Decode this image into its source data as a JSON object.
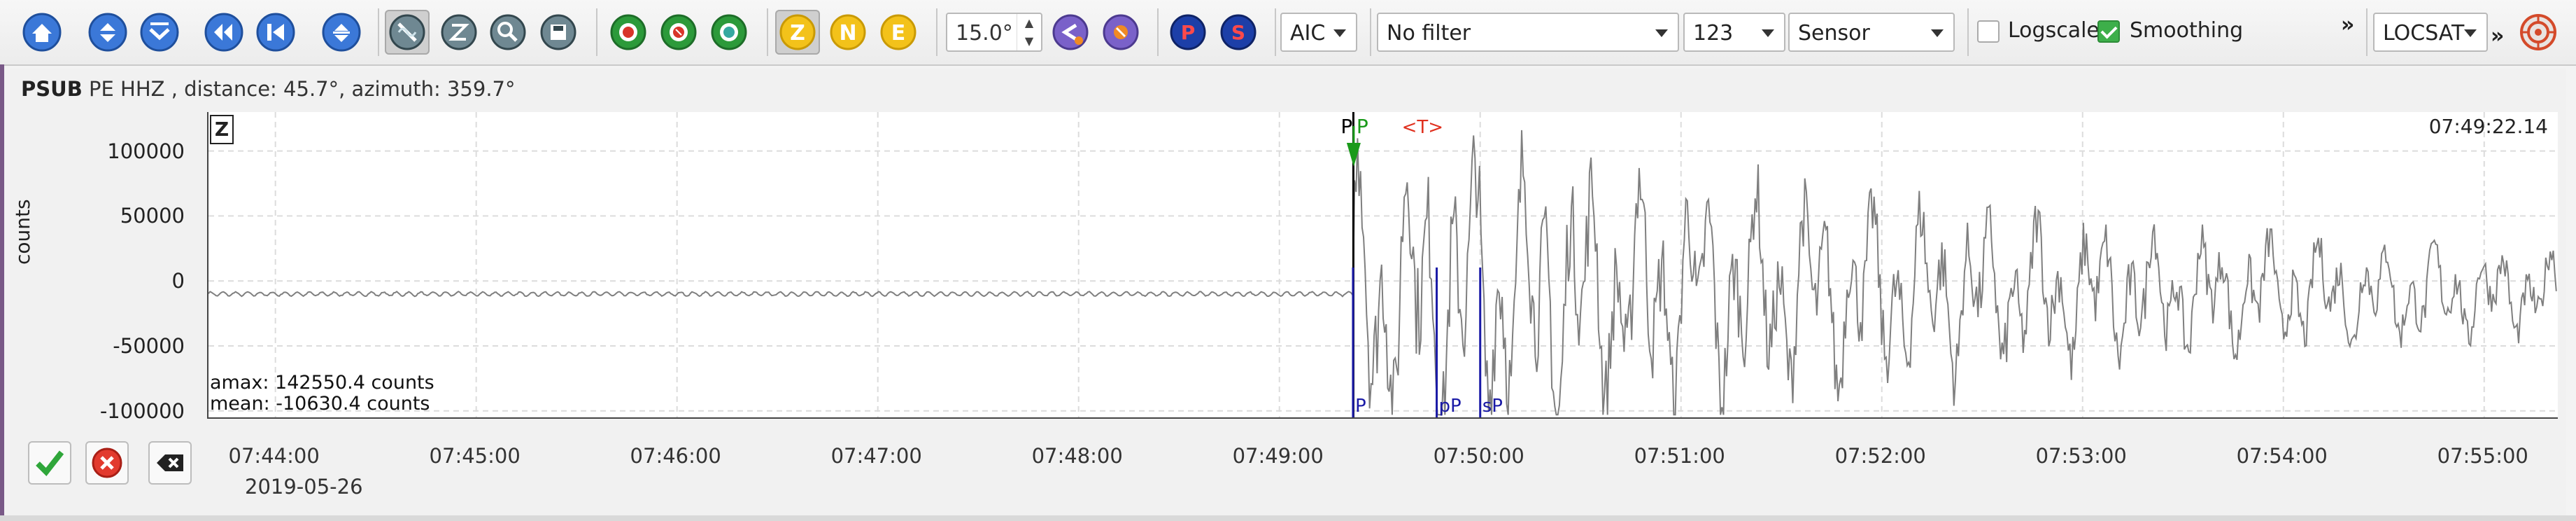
{
  "toolbar": {
    "nav_icons": [
      "home-icon",
      "up-down-icon",
      "down-icon",
      "back-icon",
      "first-icon",
      "expand-icon"
    ],
    "tool_icons": [
      "no-filter-icon",
      "zoom-icon",
      "magnify-icon",
      "save-icon"
    ],
    "phase_icons": [
      "p-phase-icon",
      "s-phase-icon",
      "relocate-icon"
    ],
    "components": {
      "z": "Z",
      "n": "N",
      "e": "E"
    },
    "spin_value": "15.0°",
    "misc_icons": [
      "trace-up-icon",
      "trace-down-icon"
    ],
    "pick_buttons": {
      "p": "P",
      "s": "S"
    },
    "method_select": "AIC",
    "filter_select": "No filter",
    "rotation_select": "123",
    "unit_select": "Sensor",
    "logscale_label": "Logscale",
    "logscale_checked": false,
    "smoothing_label": "Smoothing",
    "smoothing_checked": true,
    "more_glyph": "»",
    "locator_select": "LOCSAT",
    "locator_more_glyph": "»",
    "locator_icon": "target-icon"
  },
  "trace": {
    "station": "PSUB",
    "header_rest": "PE  HHZ , distance: 45.7°, azimuth: 359.7°",
    "component": "Z",
    "time_label": "07:49:22.14",
    "y_axis_label": "counts",
    "amax": "amax: 142550.4 counts",
    "mean": "mean: -10630.4 counts",
    "date": "2019-05-26",
    "action_icons": [
      "accept-icon",
      "reject-icon",
      "clear-icon"
    ]
  },
  "chart_data": {
    "type": "line",
    "ylabel": "counts",
    "yticks": [
      100000,
      50000,
      0,
      -50000,
      -100000
    ],
    "ylim": [
      -105000,
      130000
    ],
    "xticks": [
      "07:44:00",
      "07:45:00",
      "07:46:00",
      "07:47:00",
      "07:48:00",
      "07:49:00",
      "07:50:00",
      "07:51:00",
      "07:52:00",
      "07:53:00",
      "07:54:00",
      "07:55:00"
    ],
    "xlim": [
      "07:43:40",
      "07:55:22"
    ],
    "grid": true,
    "series_color": "#7f7f7f",
    "picks": [
      {
        "label": "P",
        "time": "07:49:22.1",
        "color": "#000000",
        "kind": "manual"
      },
      {
        "label": "P",
        "time": "07:49:22.2",
        "color": "#1a9a1a",
        "kind": "automatic"
      },
      {
        "label": "<T>",
        "time": "07:49:42",
        "color": "#e0301e",
        "kind": "theoretical"
      },
      {
        "label": "P",
        "time": "07:49:22",
        "color": "#1a1aa6",
        "kind": "predicted"
      },
      {
        "label": "pP",
        "time": "07:49:47",
        "color": "#1a1aa6",
        "kind": "predicted"
      },
      {
        "label": "sP",
        "time": "07:50:00",
        "color": "#1a1aa6",
        "kind": "predicted"
      }
    ]
  }
}
